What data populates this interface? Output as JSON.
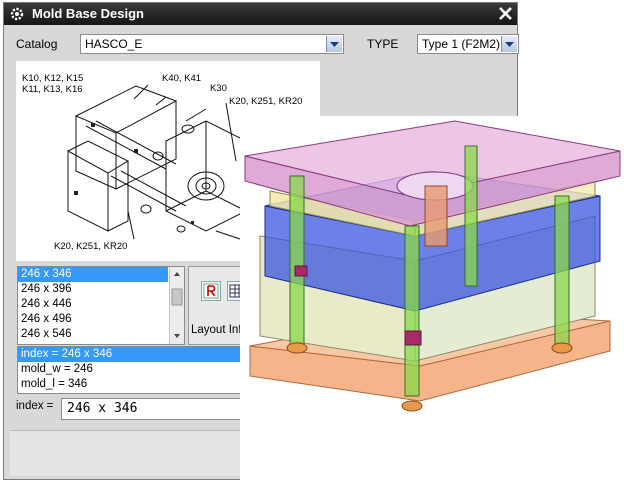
{
  "window": {
    "title": "Mold Base Design",
    "icon": "gear-icon",
    "close_icon": "close-icon"
  },
  "catalog": {
    "label": "Catalog",
    "value": "HASCO_E"
  },
  "type": {
    "label": "TYPE",
    "value": "Type 1 (F2M2)"
  },
  "diagram": {
    "callouts": {
      "top_left_1": "K10,  K12,  K15",
      "top_left_2": "K11,  K13,  K16",
      "top_right_1": "K40,  K41",
      "top_right_2": "K30",
      "right": "K20,  K251,  KR20",
      "bottom_left": "K20,  K251,  KR20"
    }
  },
  "size_list": {
    "items": [
      "246 x 346",
      "246 x 396",
      "246 x 446",
      "246 x 496",
      "246 x 546"
    ],
    "selected_index": 0
  },
  "layout_info_label": "Layout Info",
  "expressions": {
    "items": [
      "index = 246 x 346",
      "mold_w = 246",
      "mold_l = 346"
    ],
    "selected_index": 0
  },
  "index_field": {
    "label": "index =",
    "value": "246  x  346"
  },
  "colors": {
    "title_bar": "#1e1e1e",
    "selection": "#3399ff",
    "top_plate": "#d9a0d0",
    "cavity_plate": "#2f4fd8",
    "clamp_plate": "#f0a070"
  }
}
